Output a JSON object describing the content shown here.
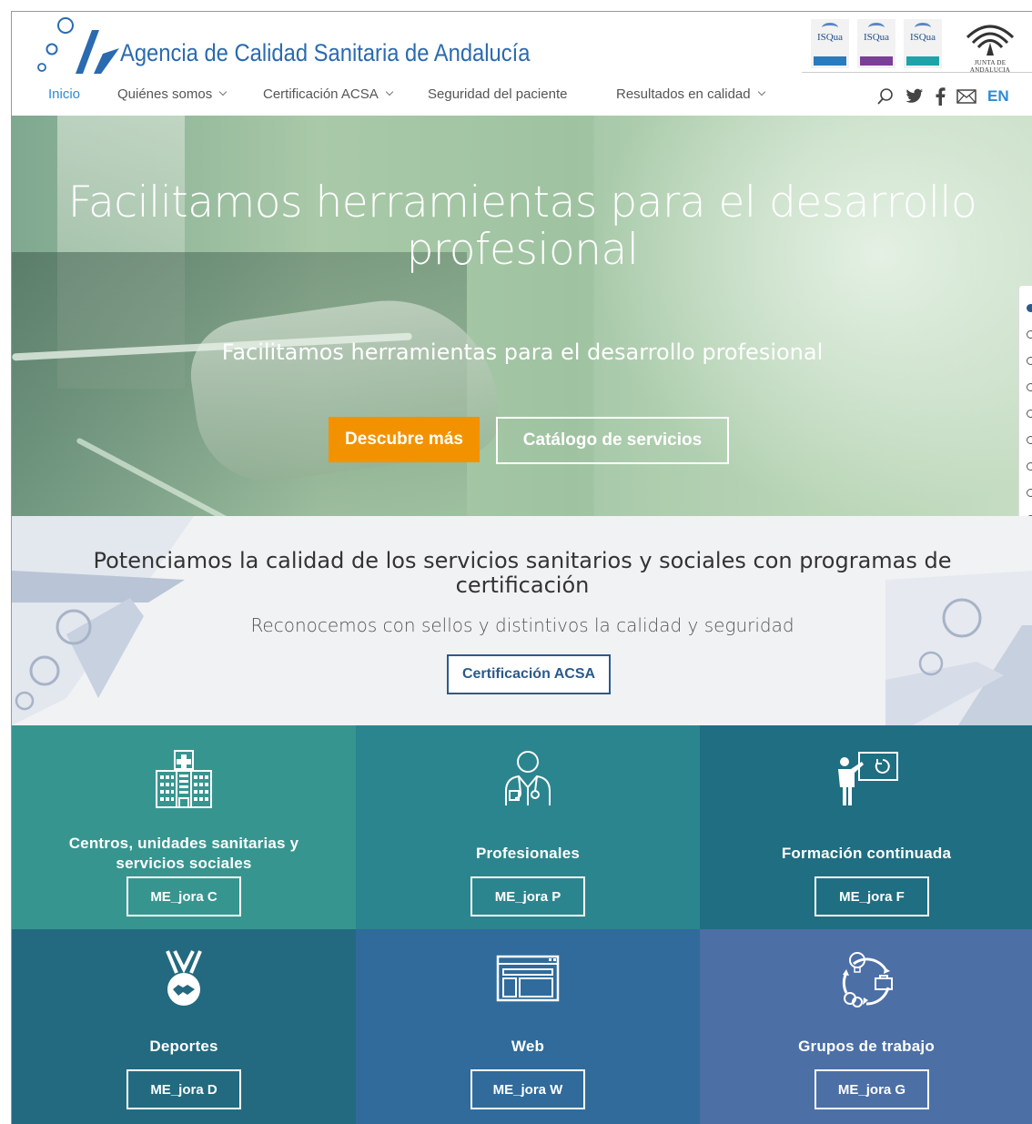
{
  "header": {
    "site_title": "Agencia de Calidad Sanitaria de Andalucía",
    "badges": [
      {
        "text": "ISQua",
        "strip_color": "#2a7bbd"
      },
      {
        "text": "ISQua",
        "strip_color": "#7a3f96"
      },
      {
        "text": "ISQua",
        "strip_color": "#1fa3a8"
      }
    ],
    "junta_text": "JUNTA DE ANDALUCIA"
  },
  "nav": {
    "items": [
      {
        "label": "Inicio",
        "active": true
      },
      {
        "label": "Quiénes somos"
      },
      {
        "label": "Certificación ACSA"
      },
      {
        "label": "Seguridad del paciente"
      },
      {
        "label": "Resultados en calidad"
      }
    ],
    "lang": "EN"
  },
  "hero": {
    "title": "Facilitamos herramientas para el desarrollo profesional",
    "subtitle": "Facilitamos herramientas para el desarrollo profesional",
    "primary_button": "Descubre más",
    "secondary_button": "Catálogo de servicios"
  },
  "certification": {
    "title": "Potenciamos la calidad de los servicios sanitarios y sociales con programas de certificación",
    "subtitle": "Reconocemos con sellos y distintivos la calidad y seguridad",
    "button": "Certificación ACSA"
  },
  "tiles": [
    {
      "title": "Centros, unidades sanitarias y servicios sociales",
      "button": "ME_jora C",
      "color": "#37958f",
      "icon": "hospital-icon"
    },
    {
      "title": "Profesionales",
      "button": "ME_jora P",
      "color": "#2b858e",
      "icon": "doctor-icon"
    },
    {
      "title": "Formación continuada",
      "button": "ME_jora F",
      "color": "#1f6e82",
      "icon": "teacher-icon"
    },
    {
      "title": "Deportes",
      "button": "ME_jora D",
      "color": "#236a80",
      "icon": "medal-icon"
    },
    {
      "title": "Web",
      "button": "ME_jora W",
      "color": "#306b9b",
      "icon": "browser-window-icon"
    },
    {
      "title": "Grupos de trabajo",
      "button": "ME_jora G",
      "color": "#4c6fa6",
      "icon": "workgroup-icon"
    }
  ],
  "colors": {
    "accent_blue": "#2d8ad6",
    "orange": "#f39200",
    "navy": "#2b5a8c"
  }
}
